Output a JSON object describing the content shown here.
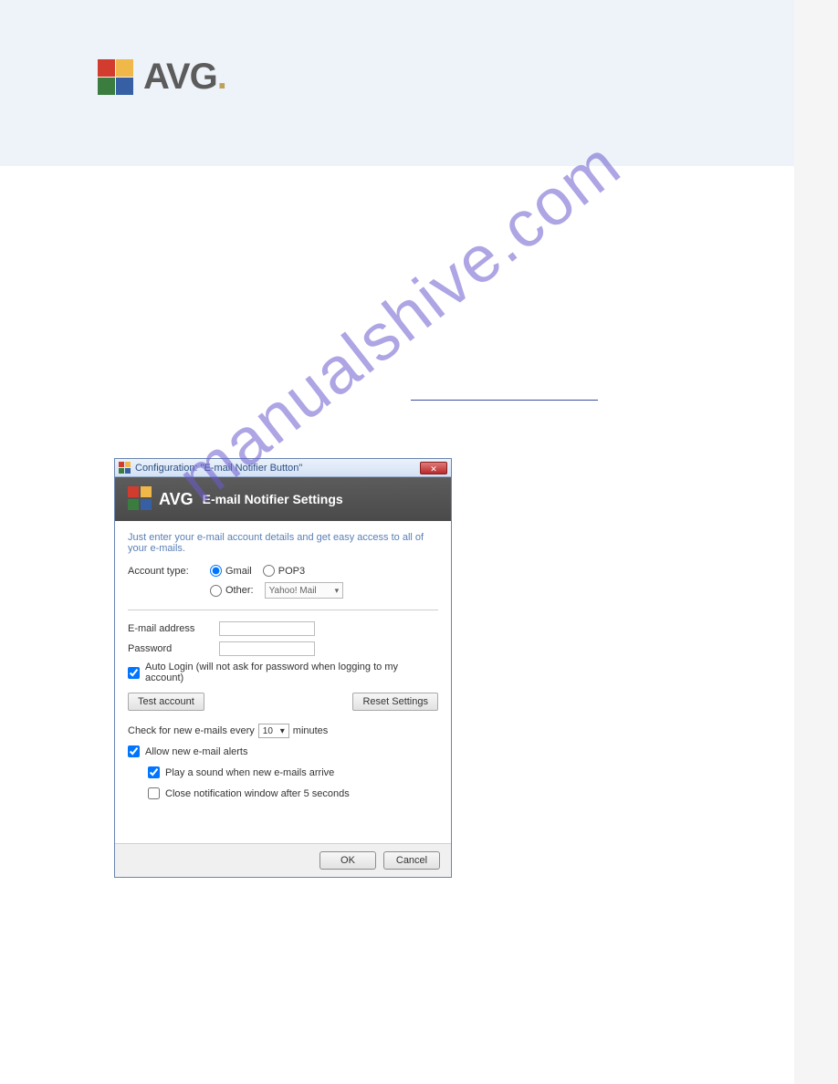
{
  "brand": {
    "name": "AVG"
  },
  "watermark": "manualshive.com",
  "dialog": {
    "window_title": "Configuration: \"E-mail Notifier Button\"",
    "header_brand": "AVG",
    "header_title": "E-mail Notifier Settings",
    "intro": "Just enter your e-mail account details and get easy access to all of your e-mails.",
    "account_type_label": "Account type:",
    "radios": {
      "gmail": "Gmail",
      "pop3": "POP3",
      "other": "Other:"
    },
    "other_select": "Yahoo! Mail",
    "email_label": "E-mail address",
    "password_label": "Password",
    "auto_login": "Auto Login (will not ask for password when logging to my account)",
    "test_btn": "Test account",
    "reset_btn": "Reset Settings",
    "check_prefix": "Check for new e-mails every",
    "check_value": "10",
    "check_suffix": "minutes",
    "allow_alerts": "Allow new e-mail alerts",
    "play_sound": "Play a sound when new e-mails arrive",
    "close_notif": "Close notification window after 5 seconds",
    "ok": "OK",
    "cancel": "Cancel"
  }
}
